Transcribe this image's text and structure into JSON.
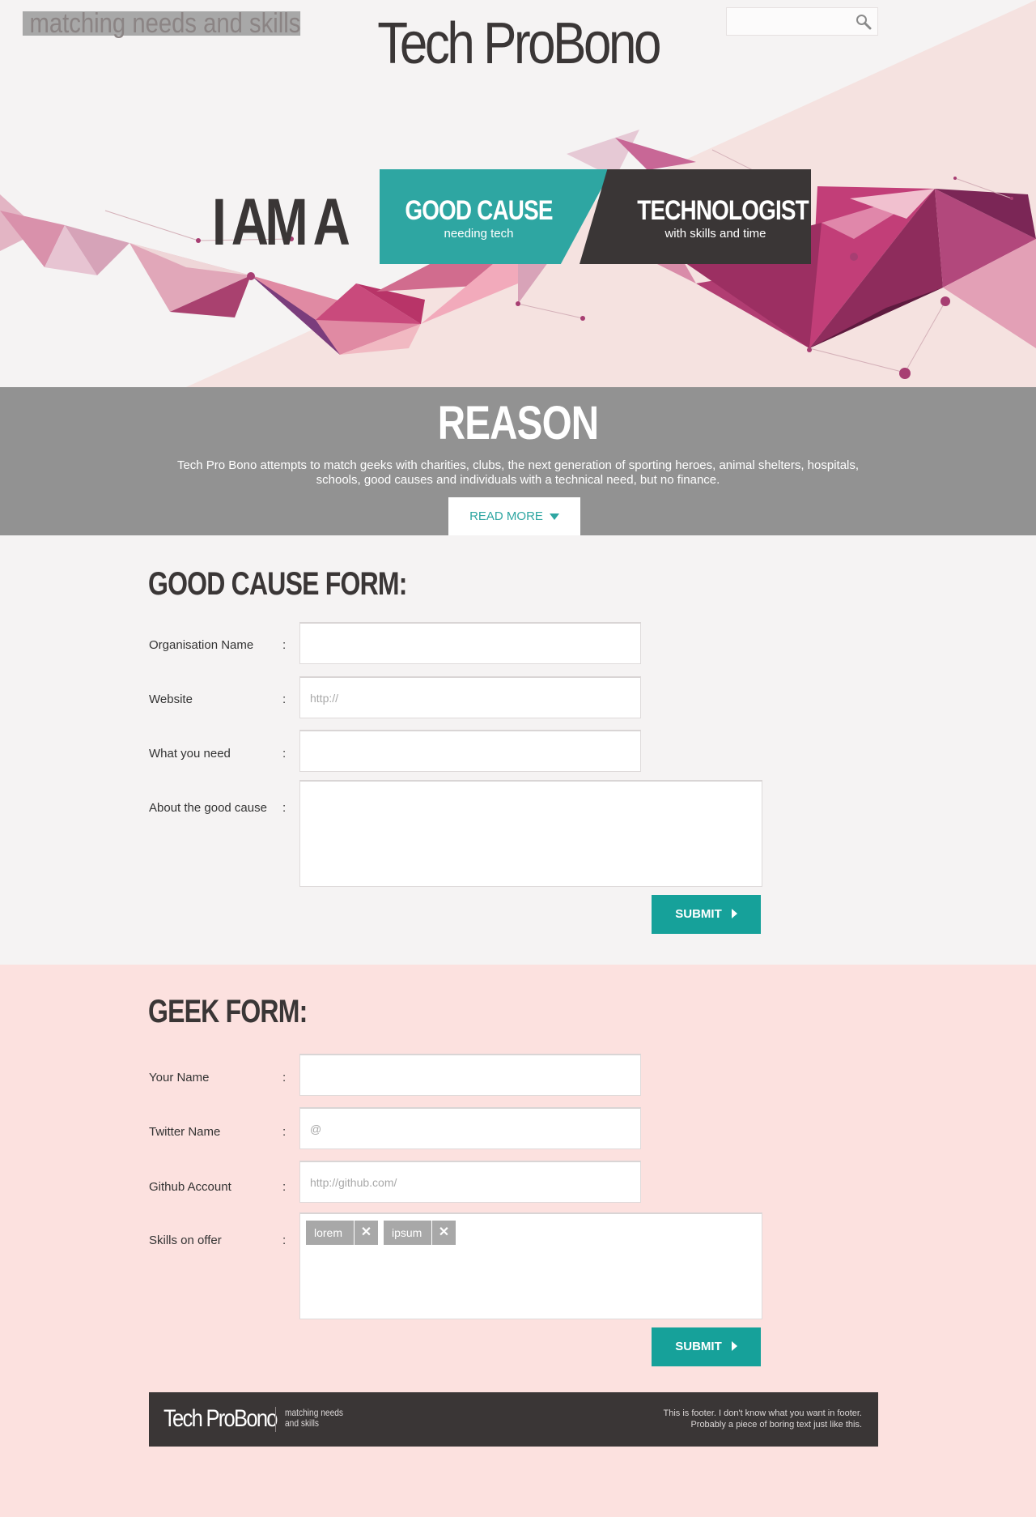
{
  "header": {
    "brand": "Tech ProBono",
    "tagline": "matching needs and skills",
    "search_placeholder": ""
  },
  "hero": {
    "prefix": "I AM A",
    "options": [
      {
        "title": "GOOD CAUSE",
        "subtitle": "needing tech"
      },
      {
        "title": "TECHNOLOGIST",
        "subtitle": "with skills and time"
      }
    ]
  },
  "reason": {
    "title": "REASON",
    "text": "Tech Pro Bono attempts to match geeks with charities, clubs, the next generation of sporting heroes, animal shelters, hospitals, schools, good causes and individuals with a technical need, but no finance.",
    "read_more": "READ MORE"
  },
  "cause_form": {
    "title": "GOOD CAUSE FORM:",
    "fields": [
      {
        "label": "Organisation Name",
        "colon": ":",
        "placeholder": ""
      },
      {
        "label": "Website",
        "colon": ":",
        "placeholder": "http://"
      },
      {
        "label": "What you need",
        "colon": ":",
        "placeholder": ""
      },
      {
        "label": "About the good cause",
        "colon": ":",
        "placeholder": ""
      }
    ],
    "submit": "SUBMIT"
  },
  "geek_form": {
    "title": "GEEK FORM:",
    "fields": [
      {
        "label": "Your Name",
        "colon": ":",
        "placeholder": ""
      },
      {
        "label": "Twitter Name",
        "colon": ":",
        "placeholder": "@"
      },
      {
        "label": "Github Account",
        "colon": ":",
        "placeholder": "http://github.com/"
      },
      {
        "label": "Skills on offer",
        "colon": ":",
        "placeholder": ""
      }
    ],
    "skills": [
      "lorem",
      "ipsum"
    ],
    "tag_remove": "✕",
    "submit": "SUBMIT"
  },
  "footer": {
    "brand": "Tech ProBono",
    "tagline": "matching needs and skills",
    "note_line1": "This is footer. I don't know what you want in footer.",
    "note_line2": "Probably a piece of boring text just like this."
  },
  "colors": {
    "teal": "#16a19a",
    "dark": "#3a3636",
    "grey_band": "#929292",
    "pink_bg": "#fce1df",
    "magenta": "#9b2e63"
  },
  "icons": {
    "search": "search-icon",
    "read_more": "caret-down-icon",
    "submit": "play-arrow-icon",
    "remove_tag": "close-icon"
  }
}
